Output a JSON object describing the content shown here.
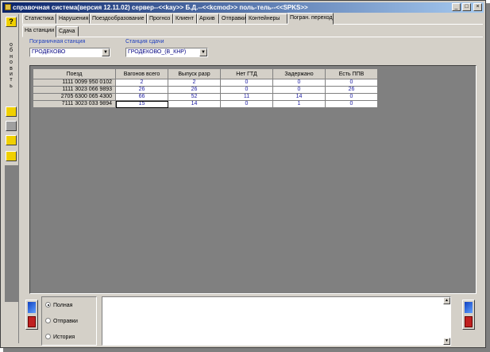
{
  "window": {
    "title": "справочная система(версия 12.11.02) сервер--<<kay>> Б.Д.--<<kcmod>> поль-тель--<<SPKS>>",
    "min_label": "_",
    "max_label": "□",
    "close_label": "×"
  },
  "toolbar": {
    "help_label": "?",
    "refresh_vertical": [
      "о",
      "б",
      "н",
      "о",
      "в",
      "и",
      "т",
      "ь"
    ]
  },
  "tabs_main": [
    "Статистика",
    "Нарушения",
    "Поездообразование",
    "Прогноз",
    "Клиент",
    "Архив",
    "Отправки",
    "Контейнеры",
    "Погран. переход"
  ],
  "tabs_sub": [
    "На станции",
    "Сдача"
  ],
  "filters": {
    "border_station_label": "Пограничная станция",
    "border_station_value": "ГРОДЕКОВО",
    "handover_station_label": "Станция сдачи",
    "handover_station_value": "ГРОДЕКОВО_(В_КНР)",
    "dropdown_arrow": "▼"
  },
  "table": {
    "columns": [
      "Поезд",
      "Вагонов всего",
      "Выпуск разр",
      "Нет ГТД",
      "Задержано",
      "Есть ППВ"
    ],
    "rows": [
      [
        "1111 0099 950 0102",
        "2",
        "2",
        "0",
        "0",
        "0"
      ],
      [
        "1111 3023 066 9893",
        "26",
        "26",
        "0",
        "0",
        "26"
      ],
      [
        "2705 6300 065 4300",
        "66",
        "52",
        "11",
        "14",
        "0"
      ],
      [
        "7111 3023 033 9894",
        "15",
        "14",
        "0",
        "1",
        "0"
      ]
    ]
  },
  "bottom": {
    "radios": [
      {
        "label": "Полная",
        "checked": true
      },
      {
        "label": "Отправки",
        "checked": false
      },
      {
        "label": "История",
        "checked": false
      }
    ],
    "scroll_up": "▲",
    "scroll_down": "▼"
  },
  "colors": {
    "title_start": "#0a246a",
    "title_end": "#a6caf0",
    "window_bg": "#d4d0c8",
    "value_text": "#1a1aa0"
  }
}
